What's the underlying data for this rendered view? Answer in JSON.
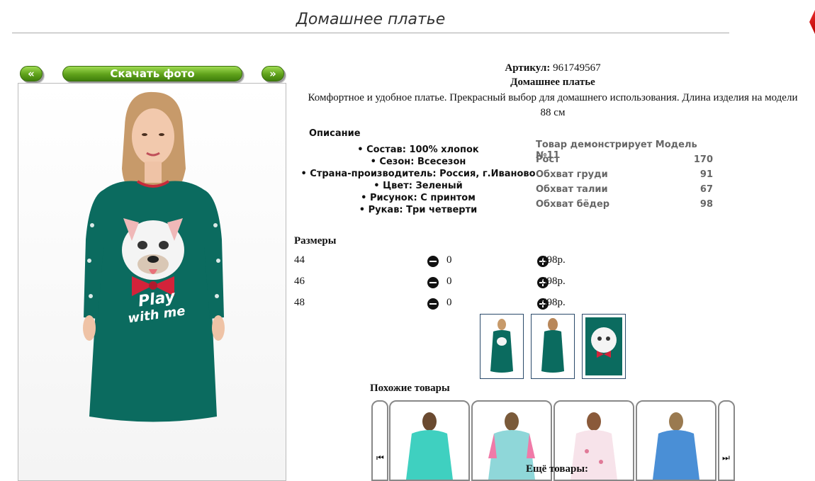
{
  "page": {
    "title": "Домашнее платье"
  },
  "nav": {
    "prev_label": "«",
    "download_label": "Скачать фото",
    "next_label": "»"
  },
  "product": {
    "article_label": "Артикул:",
    "article_value": "961749567",
    "name": "Домашнее платье",
    "description": "Комфортное и удобное платье. Прекрасный выбор для домашнего использования. Длина изделия на модели 88 см",
    "print_text_line1": "Play",
    "print_text_line2": "with me"
  },
  "specs": {
    "heading": "Описание",
    "items": [
      "Состав: 100% хлопок",
      "Сезон: Всесезон",
      "Страна-производитель: Россия, г.Иваново",
      "Цвет: Зеленый",
      "Рисунок: С принтом",
      "Рукав: Три четверти"
    ]
  },
  "model": {
    "heading": "Товар демонстрирует Модель №11",
    "rows": [
      {
        "label": "Рост",
        "value": "170"
      },
      {
        "label": "Обхват груди",
        "value": "91"
      },
      {
        "label": "Обхват талии",
        "value": "67"
      },
      {
        "label": "Обхват бёдер",
        "value": "98"
      }
    ]
  },
  "sizes": {
    "heading": "Размеры",
    "rows": [
      {
        "size": "44",
        "qty": "0",
        "price": "598р."
      },
      {
        "size": "46",
        "qty": "0",
        "price": "598р."
      },
      {
        "size": "48",
        "qty": "0",
        "price": "598р."
      }
    ]
  },
  "similar": {
    "heading": "Похожие товары",
    "more_heading": "Ещё товары:"
  },
  "colors": {
    "dress": "#0b6b5f",
    "accent": "#5fa11b",
    "bow": "#d3233a"
  },
  "icons": {
    "minus": "minus-circle-icon",
    "plus": "plus-circle-icon",
    "first": "first-page-icon",
    "last": "last-page-icon"
  }
}
